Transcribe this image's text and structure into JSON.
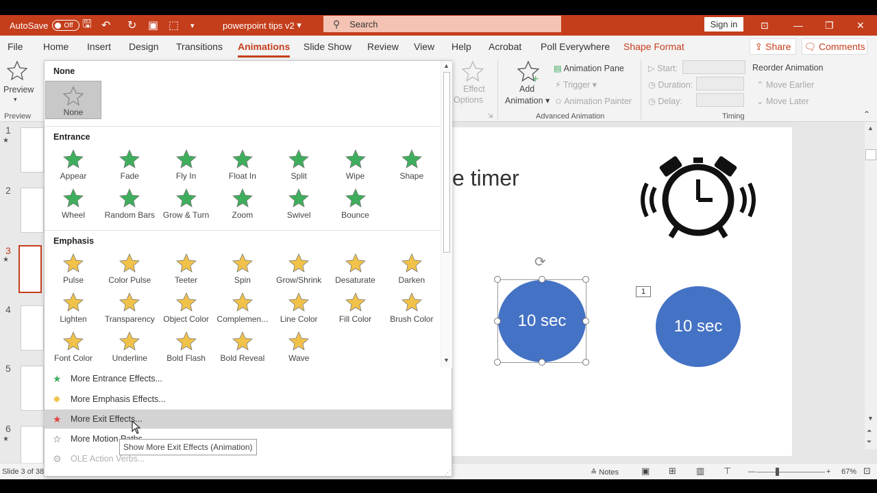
{
  "window": {
    "autosave_label": "AutoSave",
    "autosave_state": "Off",
    "title": "powerpoint tips  v2",
    "search_placeholder": "Search",
    "signin": "Sign in"
  },
  "tabs": [
    "File",
    "Home",
    "Insert",
    "Design",
    "Transitions",
    "Animations",
    "Slide Show",
    "Review",
    "View",
    "Help",
    "Acrobat",
    "Poll Everywhere",
    "Shape Format"
  ],
  "active_tab": "Animations",
  "share": "Share",
  "comments": "Comments",
  "ribbon": {
    "preview": "Preview",
    "preview_group": "Preview",
    "effect_options_1": "Effect",
    "effect_options_2": "Options",
    "add_animation_1": "Add",
    "add_animation_2": "Animation",
    "animation_pane": "Animation Pane",
    "trigger": "Trigger",
    "animation_painter": "Animation Painter",
    "advanced_group": "Advanced Animation",
    "start": "Start:",
    "duration": "Duration:",
    "delay": "Delay:",
    "timing_group": "Timing",
    "reorder": "Reorder Animation",
    "move_earlier": "Move Earlier",
    "move_later": "Move Later"
  },
  "gallery": {
    "none_title": "None",
    "none_label": "None",
    "entrance_title": "Entrance",
    "entrance": [
      "Appear",
      "Fade",
      "Fly In",
      "Float In",
      "Split",
      "Wipe",
      "Shape",
      "Wheel",
      "Random Bars",
      "Grow & Turn",
      "Zoom",
      "Swivel",
      "Bounce"
    ],
    "emphasis_title": "Emphasis",
    "emphasis": [
      "Pulse",
      "Color Pulse",
      "Teeter",
      "Spin",
      "Grow/Shrink",
      "Desaturate",
      "Darken",
      "Lighten",
      "Transparency",
      "Object Color",
      "Complemen...",
      "Line Color",
      "Fill Color",
      "Brush Color",
      "Font Color",
      "Underline",
      "Bold Flash",
      "Bold Reveal",
      "Wave"
    ],
    "menu": [
      "More Entrance Effects...",
      "More Emphasis Effects...",
      "More Exit Effects...",
      "More Motion Paths...",
      "OLE Action Verbs..."
    ],
    "tooltip": "Show More Exit Effects (Animation)"
  },
  "thumbnails": [
    "1",
    "2",
    "3",
    "4",
    "5",
    "6"
  ],
  "slide": {
    "title_fragment": "e timer",
    "circle1": "10 sec",
    "circle2": "10 sec",
    "anim_tag": "1"
  },
  "status": {
    "slide_info": "Slide 3 of 38",
    "notes": "Notes",
    "zoom": "67%"
  },
  "colors": {
    "accent": "#c43e1c",
    "entrance_star": "#3fae5c",
    "emphasis_star": "#f0c24a",
    "shape_fill": "#4472c4"
  }
}
